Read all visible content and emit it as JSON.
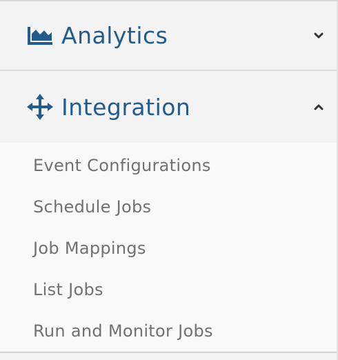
{
  "sections": [
    {
      "title": "Analytics",
      "icon": "area-chart-icon",
      "expanded": false,
      "chevron": "chevron-down-icon"
    },
    {
      "title": "Integration",
      "icon": "arrows-move-icon",
      "expanded": true,
      "chevron": "chevron-up-icon",
      "items": [
        "Event Configurations",
        "Schedule Jobs",
        "Job Mappings",
        "List Jobs",
        "Run and Monitor Jobs"
      ]
    }
  ],
  "colors": {
    "accent": "#235b8c",
    "item_text": "#717171",
    "header_bg": "#f3f3f3",
    "submenu_bg": "#f9f9f9"
  }
}
